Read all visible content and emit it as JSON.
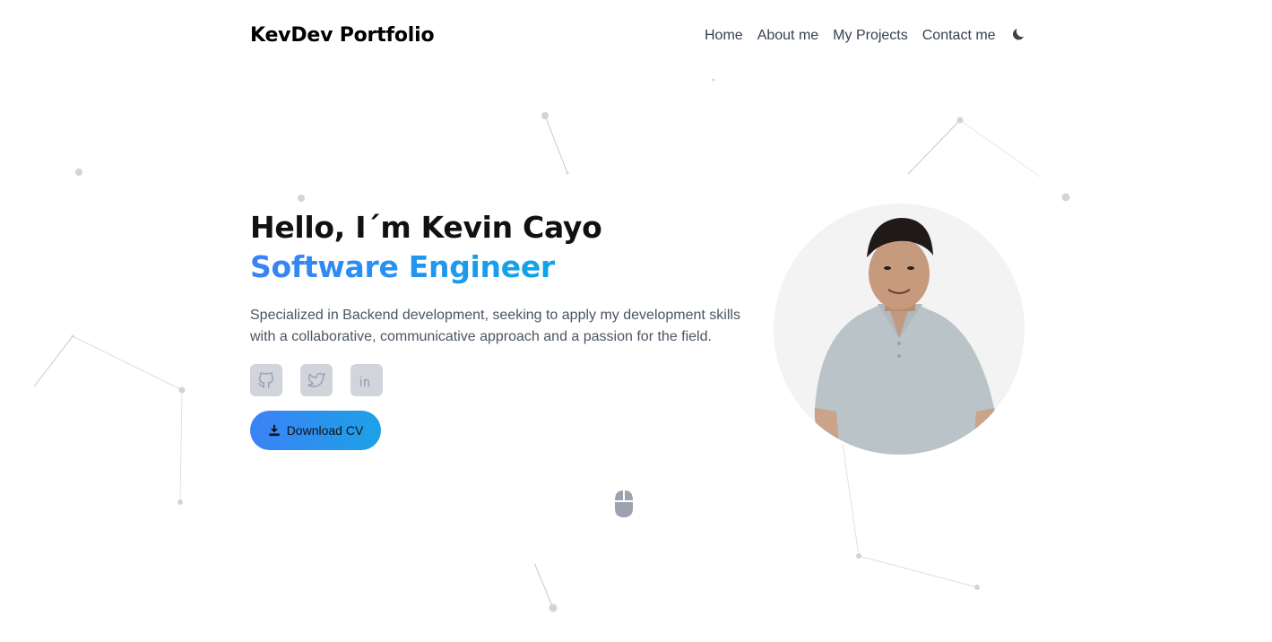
{
  "header": {
    "brand": "KevDev Portfolio",
    "nav": [
      "Home",
      "About me",
      "My Projects",
      "Contact me"
    ],
    "theme_icon": "moon-icon"
  },
  "hero": {
    "greeting": "Hello, I´m Kevin Cayo",
    "role": "Software Engineer",
    "description_lines": [
      "Specialized in Backend development, seeking to apply my development skills",
      "with a collaborative, communicative approach and a passion for the field."
    ],
    "socials": [
      "github-icon",
      "twitter-icon",
      "linkedin-icon"
    ],
    "download_label": "Download CV",
    "accent_gradient": [
      "#3b82f6",
      "#0ea5e9"
    ]
  },
  "colors": {
    "particle": "#d4d4d4",
    "particle_line": "#c8c8c8",
    "social_bg": "#d1d5db",
    "icon_gray": "#9ca3af"
  }
}
